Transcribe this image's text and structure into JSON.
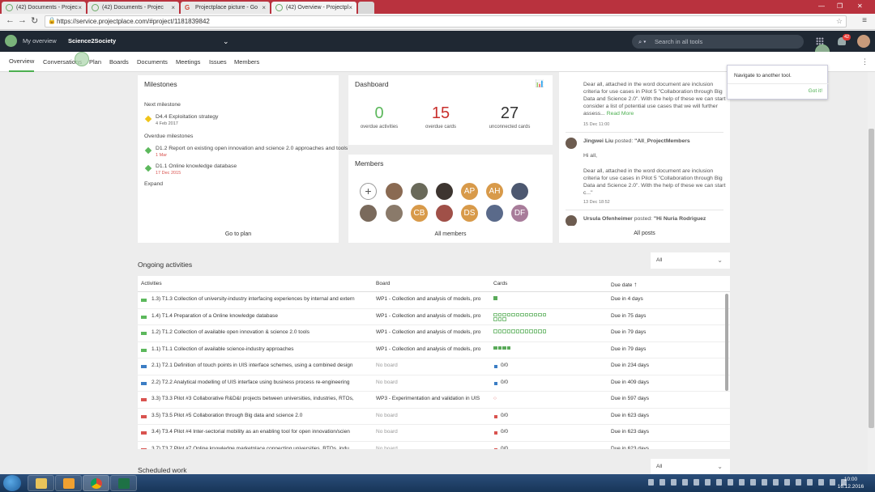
{
  "browser": {
    "tabs": [
      {
        "label": "(42) Documents - Projec"
      },
      {
        "label": "(42) Documents - Projec"
      },
      {
        "label": "Projectplace picture - Go"
      },
      {
        "label": "(42) Overview - Projectpl"
      }
    ],
    "url": "https://service.projectplace.com/#project/1181839842"
  },
  "header": {
    "my_overview": "My overview",
    "project": "Science2Society",
    "search_placeholder": "Search in all tools",
    "notif_count": "42"
  },
  "subnav": [
    "Overview",
    "Conversations",
    "Plan",
    "Boards",
    "Documents",
    "Meetings",
    "Issues",
    "Members"
  ],
  "milestones": {
    "title": "Milestones",
    "next_label": "Next milestone",
    "next": {
      "name": "D4.4 Exploitation strategy",
      "date": "4 Feb 2017"
    },
    "overdue_label": "Overdue milestones",
    "overdue": [
      {
        "name": "D1.2 Report on existing open innovation and science 2.0 approaches and tools",
        "date": "1 Mar"
      },
      {
        "name": "D1.1 Online knowledge database",
        "date": "17 Dec 2015"
      }
    ],
    "expand": "Expand",
    "footer": "Go to plan"
  },
  "dashboard": {
    "title": "Dashboard",
    "stats": [
      {
        "value": "0",
        "label": "overdue activities",
        "color": "#5cb85c"
      },
      {
        "value": "15",
        "label": "overdue cards",
        "color": "#c9302c"
      },
      {
        "value": "27",
        "label": "unconnected cards",
        "color": "#333333"
      }
    ]
  },
  "members": {
    "title": "Members",
    "initials": [
      "AP",
      "AH",
      "CB",
      "DS",
      "DF"
    ],
    "footer": "All members"
  },
  "feed": {
    "post1_text": "Dear all, attached in the word document are inclusion criteria for use cases in Pilot 5 \"Collaboration through Big Data and Science 2.0\". With the help of these we can start consider a list of potential use cases that we will further assess...",
    "read_more": "Read More",
    "post1_date": "15 Dec 11:00",
    "post2_author": "Jingwei Liu",
    "post2_verb": "posted:",
    "post2_target": "\"All_ProjectMembers",
    "post2_greeting": "Hi all,",
    "post2_text": "Dear all, attached in the word document are inclusion criteria for use cases in Pilot 5 \"Collaboration through Big Data and Science 2.0\". With the help of these we can start c...\"",
    "post2_date": "13 Dec 18:52",
    "post3_author": "Ursula Ofenheimer",
    "post3_verb": "posted:",
    "post3_target": "\"Hi Nuria Rodriguez",
    "footer": "All posts"
  },
  "popup": {
    "message": "Navigate to another tool.",
    "ok": "Got it!"
  },
  "ongoing": {
    "title": "Ongoing activities",
    "filter": "All",
    "columns": {
      "activities": "Activities",
      "board": "Board",
      "cards": "Cards",
      "due": "Due date"
    },
    "rows": [
      {
        "color": "#5cb85c",
        "activity": "1.3) T1.3 Collection of university-industry interfacing experiences by internal and extern",
        "board": "WP1 - Collection and analysis of models, pro",
        "cards": "",
        "due": "Due in 4 days",
        "boxes": [
          1
        ]
      },
      {
        "color": "#5cb85c",
        "activity": "1.4) T1.4 Preparation of a Online knowledge database",
        "board": "WP1 - Collection and analysis of models, pro",
        "cards": "",
        "due": "Due in 75 days",
        "boxes": [
          0,
          0,
          0,
          0,
          0,
          0,
          0,
          0,
          0,
          0,
          0,
          0,
          0,
          0,
          0
        ]
      },
      {
        "color": "#5cb85c",
        "activity": "1.2) T1.2 Collection of available open innovation & science 2.0 tools",
        "board": "WP1 - Collection and analysis of models, pro",
        "cards": "",
        "due": "Due in 79 days",
        "boxes": [
          0,
          0,
          0,
          0,
          0,
          0,
          0,
          0,
          0,
          0,
          0,
          0
        ]
      },
      {
        "color": "#5cb85c",
        "activity": "1.1) T1.1 Collection of available science-industry approaches",
        "board": "WP1 - Collection and analysis of models, pro",
        "cards": "",
        "due": "Due in 79 days",
        "boxes": [
          1,
          1,
          1,
          1
        ]
      },
      {
        "color": "#3b7dc4",
        "activity": "2.1) T2.1 Definition of touch points in UIS interface schemes, using a combined design",
        "board": "No board",
        "cards": "0/0",
        "due": "Due in 234 days",
        "boxes": []
      },
      {
        "color": "#3b7dc4",
        "activity": "2.2) T2.2 Analytical modelling of UIS interface using business process re-engineering",
        "board": "No board",
        "cards": "0/0",
        "due": "Due in 409 days",
        "boxes": []
      },
      {
        "color": "#d9534f",
        "activity": "3.3) T3.3 Pilot #3 Collaborative R&D&I projects between universities, industries, RTOs,",
        "board": "WP3 - Experimentation and validation in UIS",
        "cards": "○",
        "due": "Due in 597 days",
        "boxes": []
      },
      {
        "color": "#d9534f",
        "activity": "3.5) T3.5 Pilot #5 Collaboration through Big data and science 2.0",
        "board": "No board",
        "cards": "0/0",
        "due": "Due in 623 days",
        "boxes": []
      },
      {
        "color": "#d9534f",
        "activity": "3.4) T3.4 Pilot #4 Inter-sectorial mobility as an enabling tool for open innovation/scien",
        "board": "No board",
        "cards": "0/0",
        "due": "Due in 623 days",
        "boxes": []
      },
      {
        "color": "#d9534f",
        "activity": "3.7) T3.7 Pilot #7 Online knowledge marketplace connecting universities, RTOs, indu",
        "board": "No board",
        "cards": "0/0",
        "due": "Due in 623 days",
        "boxes": []
      }
    ]
  },
  "scheduled": {
    "title": "Scheduled work",
    "filter": "All"
  },
  "taskbar": {
    "time": "10:00",
    "date": "16.12.2016"
  }
}
